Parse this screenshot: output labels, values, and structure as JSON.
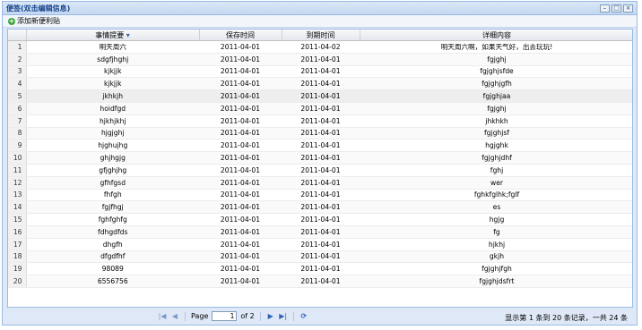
{
  "window": {
    "title": "便签(双击编辑信息)"
  },
  "toolbar": {
    "add_label": "添加新便利贴"
  },
  "table": {
    "columns": [
      "事情提要",
      "保存时间",
      "到期时间",
      "详细内容"
    ],
    "rows": [
      [
        "1",
        "明天周六",
        "2011-04-01",
        "2011-04-02",
        "明天周六啊，如果天气好，出去玩玩!"
      ],
      [
        "2",
        "sdgfjhghj",
        "2011-04-01",
        "2011-04-01",
        "fgjghj"
      ],
      [
        "3",
        "kjkjjk",
        "2011-04-01",
        "2011-04-01",
        "fgjghjsfde"
      ],
      [
        "4",
        "kjkjjk",
        "2011-04-01",
        "2011-04-01",
        "fgjghjgfh"
      ],
      [
        "5",
        "jkhkjh",
        "2011-04-01",
        "2011-04-01",
        "fgjghjaa"
      ],
      [
        "6",
        "hoidfgd",
        "2011-04-01",
        "2011-04-01",
        "fgjghj"
      ],
      [
        "7",
        "hjkhjkhj",
        "2011-04-01",
        "2011-04-01",
        "jhkhkh"
      ],
      [
        "8",
        "hjgjghj",
        "2011-04-01",
        "2011-04-01",
        "fgjghjsf"
      ],
      [
        "9",
        "hjghujhg",
        "2011-04-01",
        "2011-04-01",
        "hgjghk"
      ],
      [
        "10",
        "ghjhgjg",
        "2011-04-01",
        "2011-04-01",
        "fgjghjdhf"
      ],
      [
        "11",
        "gfjghjhg",
        "2011-04-01",
        "2011-04-01",
        "fghj"
      ],
      [
        "12",
        "gfhfgsd",
        "2011-04-01",
        "2011-04-01",
        "wer"
      ],
      [
        "13",
        "fhfgh",
        "2011-04-01",
        "2011-04-01",
        "fghkfglhk;fglf"
      ],
      [
        "14",
        "fgjfhgj",
        "2011-04-01",
        "2011-04-01",
        "es"
      ],
      [
        "15",
        "fghfghfg",
        "2011-04-01",
        "2011-04-01",
        "hgjg"
      ],
      [
        "16",
        "fdhgdfds",
        "2011-04-01",
        "2011-04-01",
        "fg"
      ],
      [
        "17",
        "dhgfh",
        "2011-04-01",
        "2011-04-01",
        "hjkhj"
      ],
      [
        "18",
        "dfgdfhf",
        "2011-04-01",
        "2011-04-01",
        "gkjh"
      ],
      [
        "19",
        "98089",
        "2011-04-01",
        "2011-04-01",
        "fgjghjfgh"
      ],
      [
        "20",
        "6556756",
        "2011-04-01",
        "2011-04-01",
        "fgjghjdsfrt"
      ]
    ],
    "selected_row": 5
  },
  "paging": {
    "page_label": "Page",
    "page_value": "1",
    "of_label": "of 2",
    "display_text": "显示第  1 条到  20 条记录，一共  24 条"
  },
  "icons": {
    "first": "first-page-icon",
    "prev": "prev-page-icon",
    "next": "next-page-icon",
    "last": "last-page-icon",
    "refresh": "refresh-icon"
  }
}
